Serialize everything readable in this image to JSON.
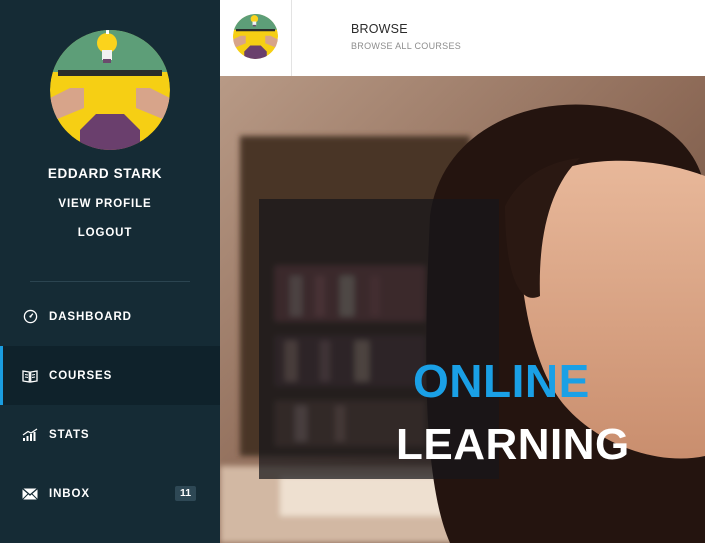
{
  "sidebar": {
    "user_name": "EDDARD STARK",
    "view_profile": "VIEW PROFILE",
    "logout": "LOGOUT",
    "nav": [
      {
        "label": "DASHBOARD",
        "icon": "dashboard-icon",
        "active": false
      },
      {
        "label": "COURSES",
        "icon": "book-icon",
        "active": true
      },
      {
        "label": "STATS",
        "icon": "stats-icon",
        "active": false
      },
      {
        "label": "INBOX",
        "icon": "envelope-icon",
        "active": false,
        "badge": "11"
      }
    ]
  },
  "header": {
    "title": "BROWSE",
    "subtitle": "BROWSE ALL COURSES"
  },
  "hero": {
    "line1": "ONLINE",
    "line2": "LEARNING"
  },
  "colors": {
    "sidebar_bg": "#152b35",
    "active_bg": "#0f222b",
    "accent": "#1a9de0",
    "badge_bg": "#2e4855"
  }
}
